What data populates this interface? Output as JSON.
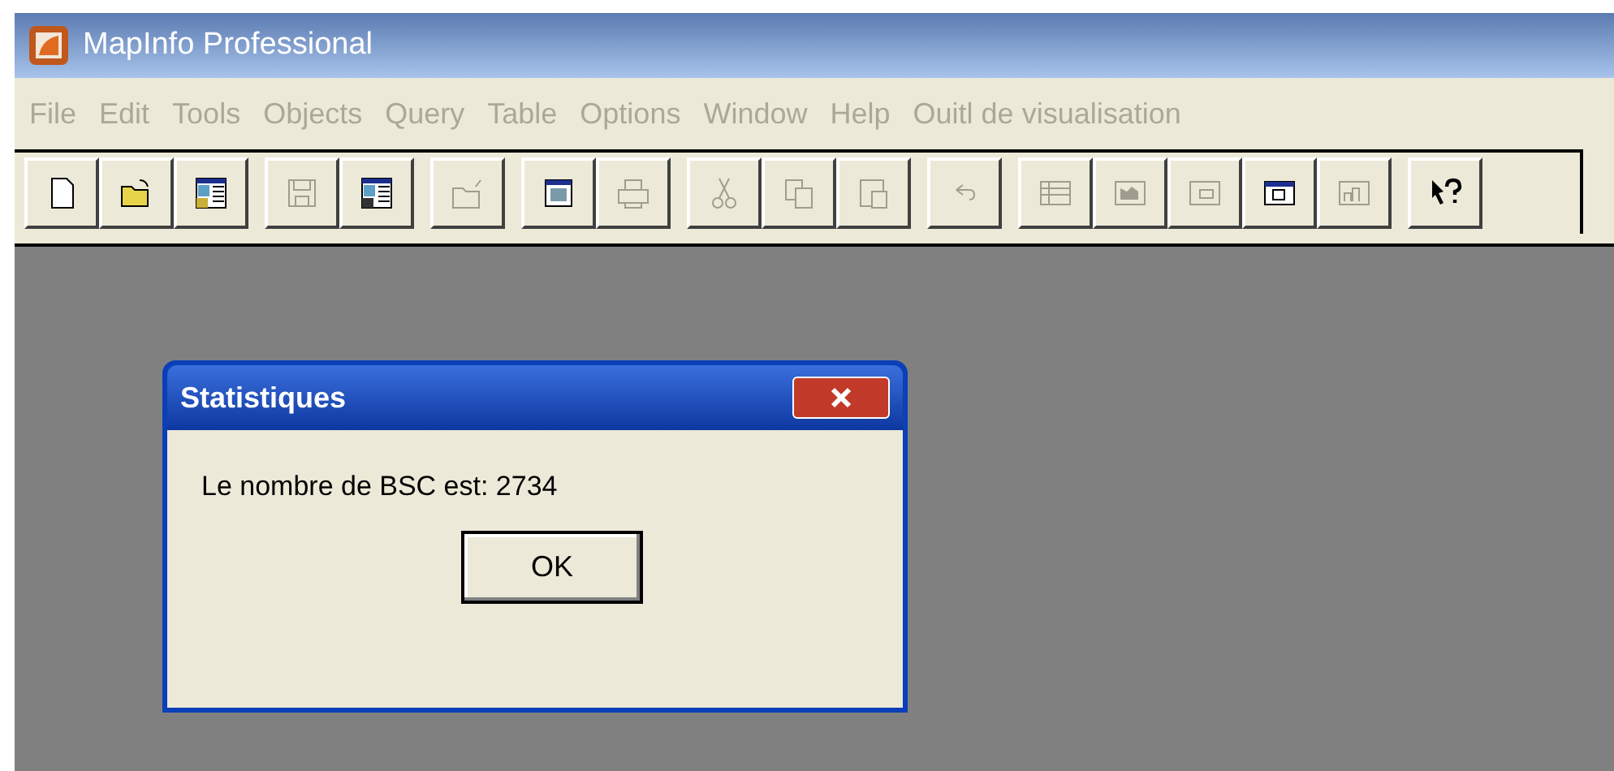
{
  "window": {
    "title": "MapInfo Professional"
  },
  "menu": [
    {
      "label": "File",
      "disabled": true
    },
    {
      "label": "Edit",
      "disabled": true
    },
    {
      "label": "Tools",
      "disabled": true
    },
    {
      "label": "Objects",
      "disabled": true
    },
    {
      "label": "Query",
      "disabled": true
    },
    {
      "label": "Table",
      "disabled": true
    },
    {
      "label": "Options",
      "disabled": true
    },
    {
      "label": "Window",
      "disabled": true
    },
    {
      "label": "Help",
      "disabled": true
    },
    {
      "label": "Ouitl de visualisation",
      "disabled": true
    }
  ],
  "toolbar": [
    [
      {
        "kind": "new",
        "disabled": false
      },
      {
        "kind": "open",
        "disabled": false
      },
      {
        "kind": "workspace",
        "disabled": false
      }
    ],
    [
      {
        "kind": "save",
        "disabled": true
      },
      {
        "kind": "saveworkspace",
        "disabled": false
      }
    ],
    [
      {
        "kind": "close",
        "disabled": true
      }
    ],
    [
      {
        "kind": "mapwindow",
        "disabled": false
      },
      {
        "kind": "print",
        "disabled": true
      }
    ],
    [
      {
        "kind": "cut",
        "disabled": true
      },
      {
        "kind": "copy",
        "disabled": true
      },
      {
        "kind": "paste",
        "disabled": true
      }
    ],
    [
      {
        "kind": "undo",
        "disabled": true
      }
    ],
    [
      {
        "kind": "browser",
        "disabled": true
      },
      {
        "kind": "map",
        "disabled": true
      },
      {
        "kind": "layout",
        "disabled": true
      },
      {
        "kind": "window",
        "disabled": false
      },
      {
        "kind": "graph",
        "disabled": true
      }
    ],
    [
      {
        "kind": "help",
        "disabled": false
      }
    ]
  ],
  "dialog": {
    "title": "Statistiques",
    "message": "Le nombre de BSC est: 2734",
    "button": "OK"
  }
}
